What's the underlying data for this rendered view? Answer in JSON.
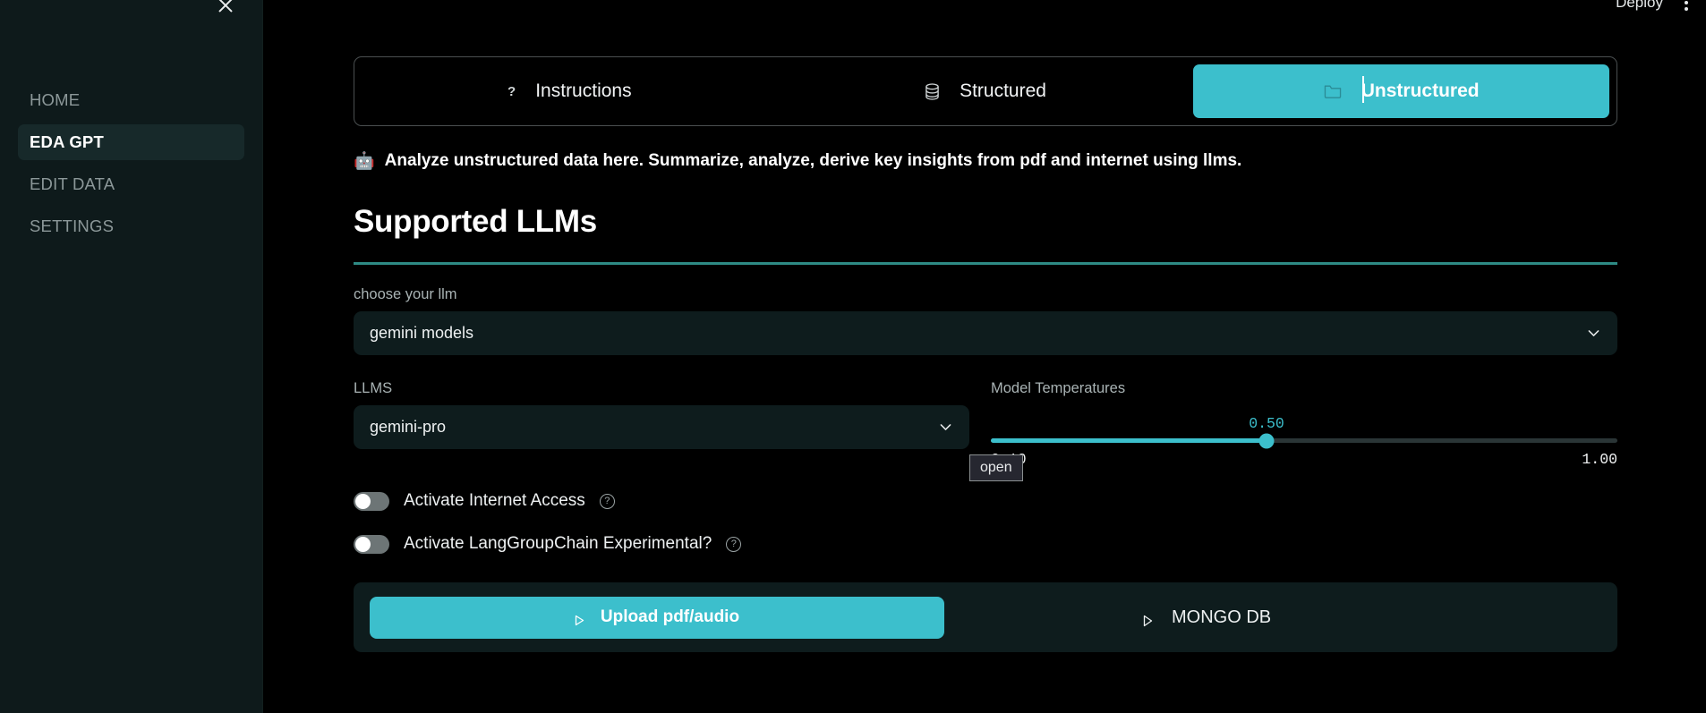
{
  "sidebar": {
    "close_icon": "close-icon",
    "items": [
      {
        "label": "HOME",
        "active": false
      },
      {
        "label": "EDA GPT",
        "active": true
      },
      {
        "label": "EDIT DATA",
        "active": false
      },
      {
        "label": "SETTINGS",
        "active": false
      }
    ]
  },
  "topbar": {
    "deploy_label": "Deploy",
    "menu_icon": "kebab-menu-icon"
  },
  "tabs": [
    {
      "label": "Instructions",
      "icon": "question-mark-icon",
      "selected": false
    },
    {
      "label": "Structured",
      "icon": "database-icon",
      "selected": false
    },
    {
      "label": "Unstructured",
      "icon": "folder-icon",
      "selected": true
    }
  ],
  "banner": {
    "emoji": "🤖",
    "text": "Analyze unstructured data here. Summarize, analyze, derive key insights from pdf and internet using llms."
  },
  "section": {
    "heading": "Supported LLMs",
    "choose_llm_label": "choose your llm",
    "llm_provider_value": "gemini models",
    "llms_label": "LLMS",
    "llm_model_value": "gemini-pro",
    "tooltip_text": "open"
  },
  "temperature": {
    "label": "Model Temperatures",
    "value": "0.50",
    "min": "0.10",
    "max": "1.00",
    "percent": 44,
    "accent_color": "#3cbfcc"
  },
  "toggles": [
    {
      "label": "Activate Internet Access",
      "on": false,
      "help_icon": "help-circle-icon"
    },
    {
      "label": "Activate LangGroupChain Experimental?",
      "on": false,
      "help_icon": "help-circle-icon"
    }
  ],
  "expanders": [
    {
      "label": "Upload pdf/audio",
      "icon": "triangle-right-icon",
      "primary": true
    },
    {
      "label": "MONGO DB",
      "icon": "triangle-right-icon",
      "primary": false
    }
  ],
  "colors": {
    "accent": "#3cbfcc",
    "divider": "#2e8b85",
    "sidebar_bg": "#0e1a1b",
    "panel_bg": "#0e1c1d",
    "page_bg": "#000000"
  }
}
